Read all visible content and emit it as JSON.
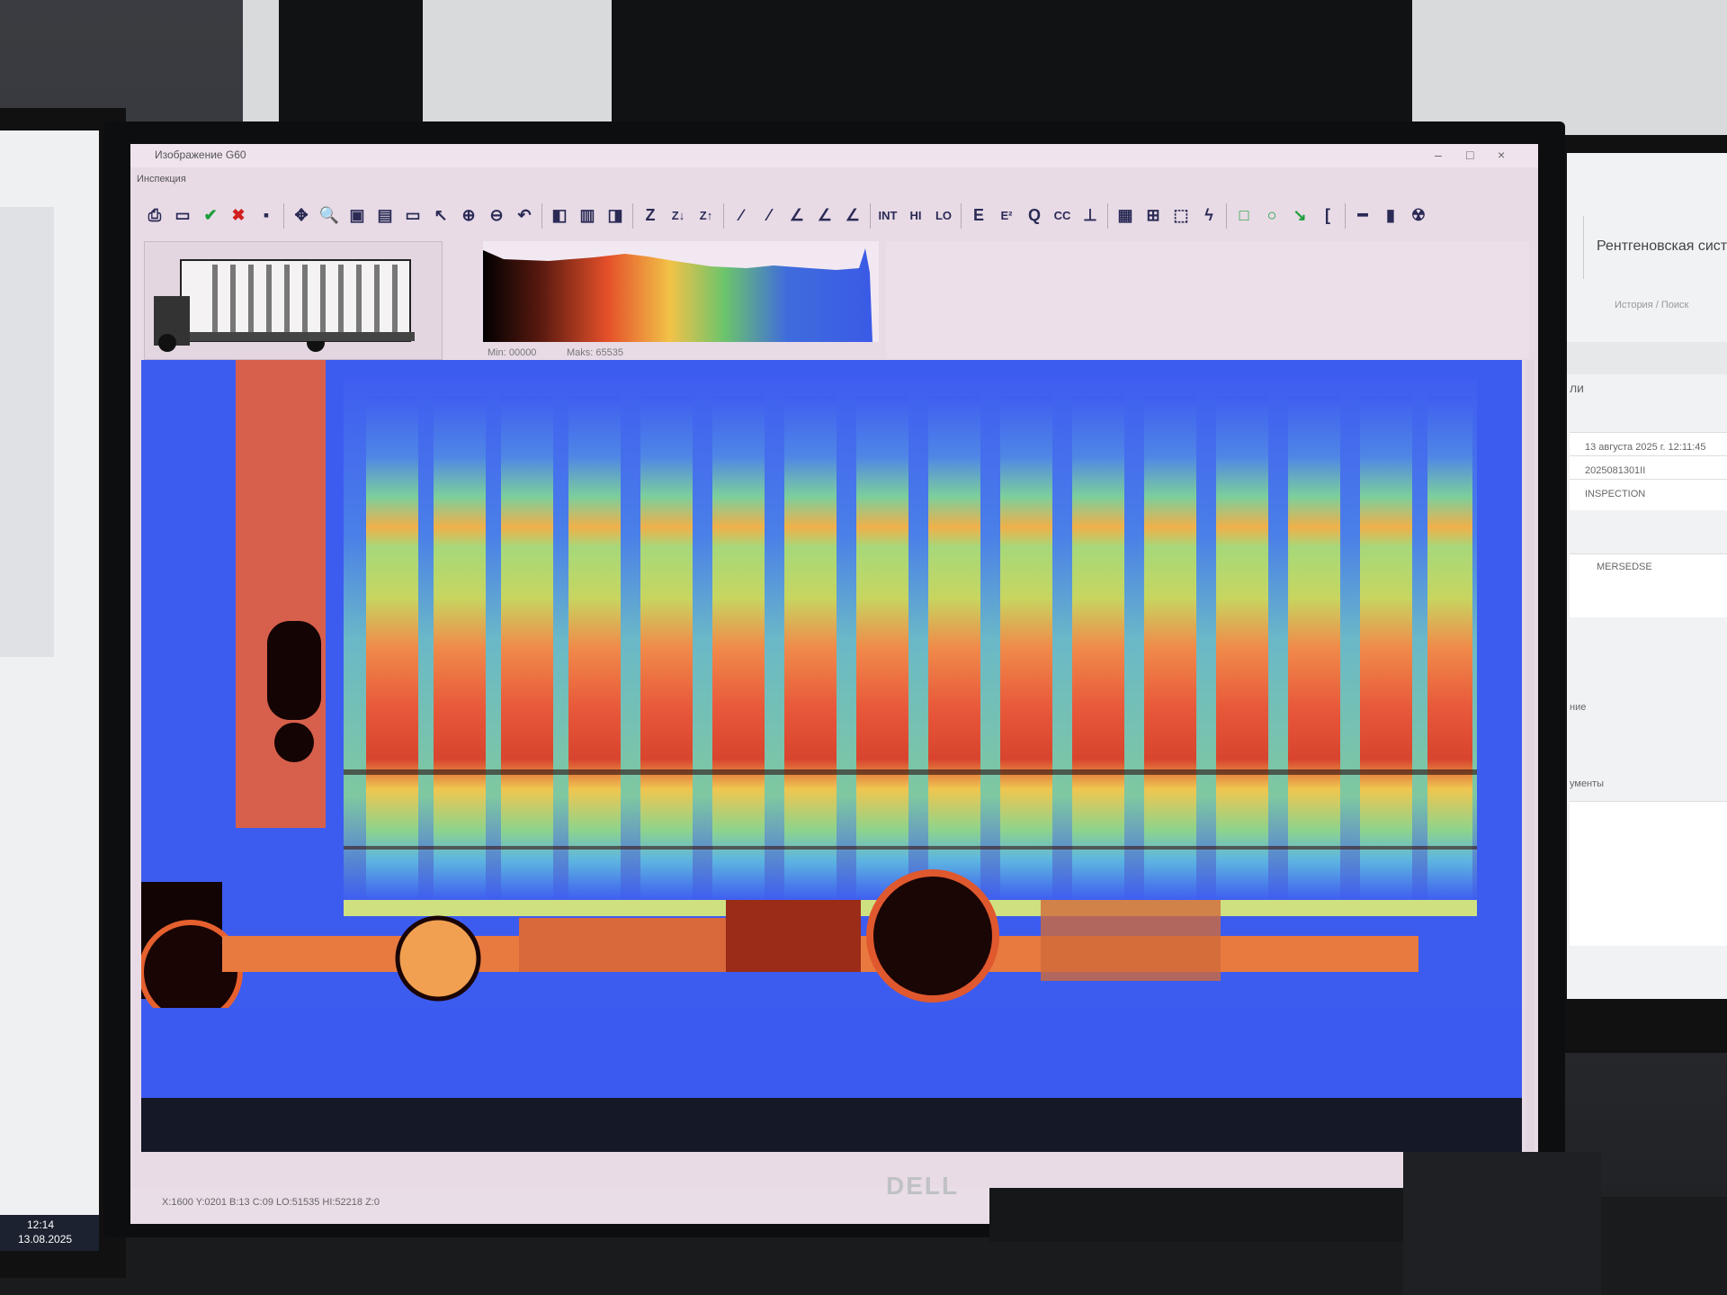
{
  "window": {
    "title": "Изображение G60",
    "menu": "Инспекция",
    "minimize": "–",
    "maximize": "□",
    "close": "×"
  },
  "toolbar": {
    "tools": [
      {
        "name": "print-icon",
        "glyph": "⎙"
      },
      {
        "name": "chat-icon",
        "glyph": "▭"
      },
      {
        "name": "accept-icon",
        "glyph": "✔",
        "color": "#1e9e3a"
      },
      {
        "name": "reject-icon",
        "glyph": "✖",
        "color": "#d11e1e"
      },
      {
        "name": "save-icon",
        "glyph": "▪"
      },
      {
        "name": "pan-icon",
        "glyph": "✥"
      },
      {
        "name": "zoom-icon",
        "glyph": "🔍"
      },
      {
        "name": "fit-icon",
        "glyph": "▣"
      },
      {
        "name": "scanner-icon",
        "glyph": "▤"
      },
      {
        "name": "monitor-icon",
        "glyph": "▭"
      },
      {
        "name": "select-zoom-icon",
        "glyph": "↖"
      },
      {
        "name": "zoom-in-icon",
        "glyph": "⊕"
      },
      {
        "name": "zoom-out-icon",
        "glyph": "⊖"
      },
      {
        "name": "undo-icon",
        "glyph": "↶"
      },
      {
        "name": "grayscale-icon",
        "glyph": "◧"
      },
      {
        "name": "color-palette-icon",
        "glyph": "▥"
      },
      {
        "name": "invert-icon",
        "glyph": "◨"
      },
      {
        "name": "z-icon",
        "label": "Z"
      },
      {
        "name": "z-down-icon",
        "label": "Z↓"
      },
      {
        "name": "z-up-icon",
        "label": "Z↑"
      },
      {
        "name": "curve-1-icon",
        "glyph": "∕"
      },
      {
        "name": "curve-2-icon",
        "glyph": "⁄"
      },
      {
        "name": "curve-3-icon",
        "glyph": "∠"
      },
      {
        "name": "curve-4-icon",
        "glyph": "∠"
      },
      {
        "name": "curve-5-icon",
        "glyph": "∠"
      },
      {
        "name": "int-button",
        "label": "INT"
      },
      {
        "name": "hi-button",
        "label": "HI"
      },
      {
        "name": "lo-button",
        "label": "LO"
      },
      {
        "name": "e-button",
        "label": "E"
      },
      {
        "name": "e2-button",
        "label": "E²"
      },
      {
        "name": "q-button",
        "label": "Q"
      },
      {
        "name": "cc-button",
        "label": "CC"
      },
      {
        "name": "axis-icon",
        "glyph": "⊥"
      },
      {
        "name": "layers-icon",
        "glyph": "▦"
      },
      {
        "name": "grid-icon",
        "glyph": "⊞"
      },
      {
        "name": "region-icon",
        "glyph": "⬚"
      },
      {
        "name": "lasso-icon",
        "glyph": "ϟ"
      },
      {
        "name": "rectangle-icon",
        "glyph": "□",
        "color": "#1e9e3a"
      },
      {
        "name": "circle-icon",
        "glyph": "○",
        "color": "#1e9e3a"
      },
      {
        "name": "arrow-icon",
        "glyph": "↘",
        "color": "#1e9e3a"
      },
      {
        "name": "bracket-icon",
        "glyph": "["
      },
      {
        "name": "ruler-icon",
        "glyph": "━"
      },
      {
        "name": "panel-icon",
        "glyph": "▮"
      },
      {
        "name": "radiation-icon",
        "glyph": "☢"
      }
    ]
  },
  "histogram": {
    "min_label": "Min: 00000",
    "max_label": "Maks: 65535"
  },
  "status": {
    "text": "X:1600 Y:0201 B:13 C:09 LO:51535 HI:52218 Z:0"
  },
  "right_screen": {
    "title": "Рентгеновская сист",
    "subtitle": "История / Поиск",
    "section_1": "ли",
    "date": "13 августа 2025 г. 12:11:45",
    "id": "2025081301II",
    "mode": "INSPECTION",
    "vehicle": "MERSEDSE",
    "section_2": "ние",
    "section_3": "ументы"
  },
  "left_screen": {
    "clock": "12:14",
    "date": "13.08.2025"
  },
  "monitor": {
    "brand": "DELL"
  }
}
